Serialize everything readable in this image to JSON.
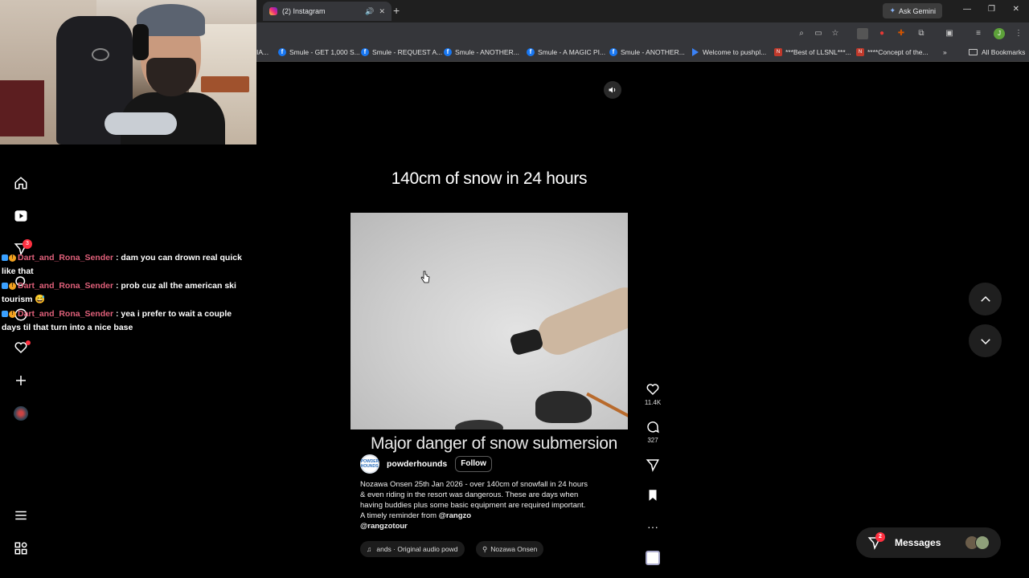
{
  "browser": {
    "tab_title": "(2) Instagram",
    "new_tab": "+",
    "ask_gemini": "Ask Gemini",
    "bookmarks": [
      "Smule - GET 1,000 S...",
      "Smule - REQUEST A...",
      "Smule - ANOTHER...",
      "Smule - A MAGIC PI...",
      "Smule - ANOTHER...",
      "Welcome to pushpl...",
      "***Best of LLSNL***...",
      "****Concept of the..."
    ],
    "bookmark_partial": "IA...",
    "all_bookmarks": "All Bookmarks",
    "profile_initial": "J"
  },
  "nav": {
    "notifications_badge": "3"
  },
  "chat": [
    {
      "user": "Dart_and_Rona_Sender",
      "text": ": dam you can drown real quick like that"
    },
    {
      "user": "Dart_and_Rona_Sender",
      "text": ": prob cuz all the american ski tourism 😅"
    },
    {
      "user": "Dart_and_Rona_Sender",
      "text": ": yea i prefer to wait a couple days til that turn into a nice base"
    }
  ],
  "reel": {
    "headline": "140cm of snow in 24 hours",
    "subtitle": "Major danger of snow submersion",
    "author": "powderhounds",
    "author_avatar_text": "POWDER HOUNDS",
    "follow": "Follow",
    "caption": "Nozawa Onsen 25th Jan 2026 - over 140cm of snowfall in 24 hours & even riding in the resort was dangerous. These are days when having buddies plus some basic equipment are required important. A timely reminder from ",
    "mention1": "@rangzo",
    "mention2": "@rangzotour",
    "audio": "ands · Original audio  powd",
    "location": "Nozawa Onsen"
  },
  "actions": {
    "likes": "11.4K",
    "comments": "327"
  },
  "messages": {
    "label": "Messages",
    "badge": "2"
  },
  "colors": {
    "background": "#000000",
    "chat_user": "#e0607a",
    "badge_red": "#ff3040"
  }
}
